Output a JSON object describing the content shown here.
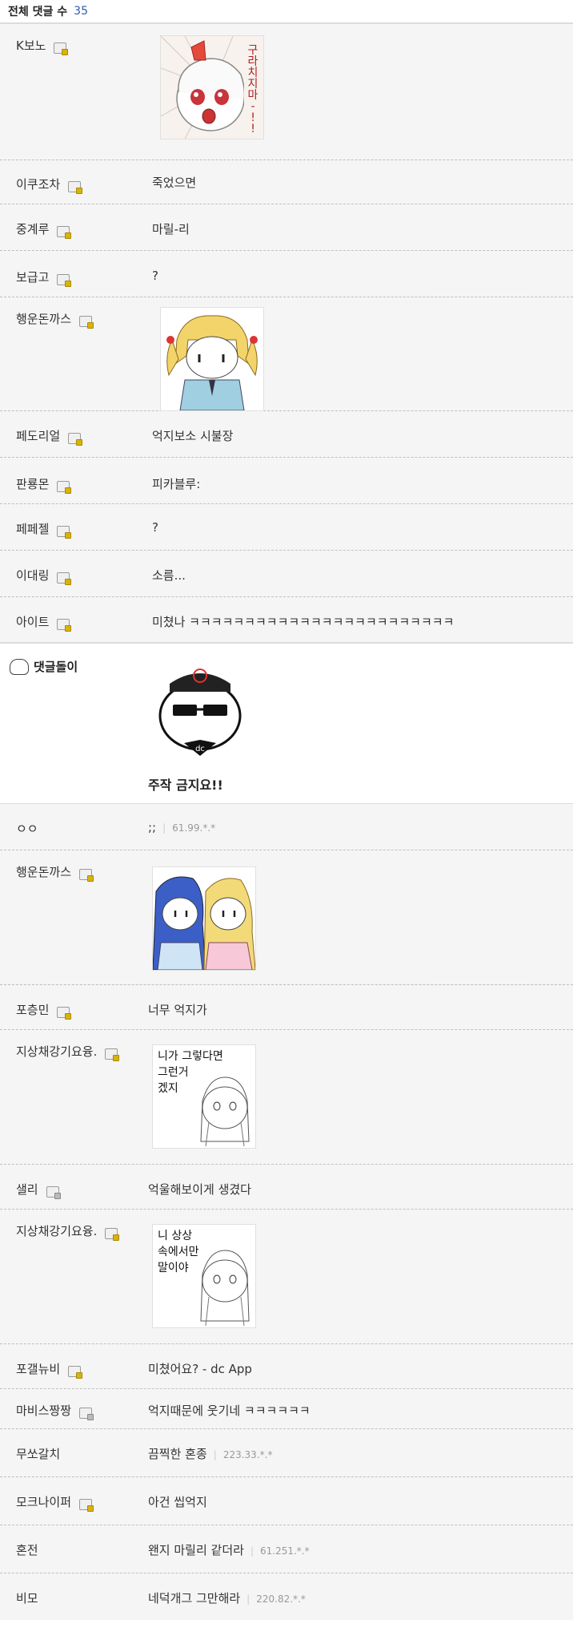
{
  "header": {
    "title": "전체 댓글 수",
    "count": "35"
  },
  "comments": [
    {
      "nick": "K보노",
      "memo": ""
    },
    {
      "nick": "이쿠조차",
      "memo": "죽었으면"
    },
    {
      "nick": "중계루",
      "memo": "마릴-리"
    },
    {
      "nick": "보급고",
      "memo": "?"
    },
    {
      "nick": "행운돈까스",
      "memo": ""
    },
    {
      "nick": "페도리얼",
      "memo": "억지보소 시불장"
    },
    {
      "nick": "판룡몬",
      "memo": "피카블루:"
    },
    {
      "nick": "페페젤",
      "memo": "?"
    },
    {
      "nick": "이대링",
      "memo": "소름..."
    },
    {
      "nick": "아이트",
      "memo": "미쳤나 ㅋㅋㅋㅋㅋㅋㅋㅋㅋㅋㅋㅋㅋㅋㅋㅋㅋㅋㅋㅋㅋㅋㅋㅋ"
    }
  ],
  "bot": {
    "name": "댓글돌이",
    "caption": "주작 금지요!!",
    "badge": "dc"
  },
  "manga": {
    "k_bono": "구라치지마-!!",
    "jisang1": [
      "니가 그렇다면",
      "그런거",
      "겠지"
    ],
    "jisang2": [
      "니 상상",
      "속에서만",
      "말이야"
    ]
  },
  "comments2": [
    {
      "nick": "ㅇㅇ",
      "memo": ";;",
      "ip": "61.99.*.*"
    },
    {
      "nick": "행운돈까스",
      "memo": ""
    },
    {
      "nick": "포층민",
      "memo": "너무 억지가"
    },
    {
      "nick": "지상채강기요융.",
      "memo": ""
    },
    {
      "nick": "샐리",
      "memo": "억울해보이게 생겼다"
    },
    {
      "nick": "지상채강기요융.",
      "memo": ""
    },
    {
      "nick": "포갤뉴비",
      "memo": "미쳤어요? - dc App"
    },
    {
      "nick": "마비스짱짱",
      "memo": "억지때문에 웃기네 ㅋㅋㅋㅋㅋㅋ"
    },
    {
      "nick": "무쏘갈치",
      "memo": "끔찍한 혼종",
      "ip": "223.33.*.*"
    },
    {
      "nick": "모크나이퍼",
      "memo": "아건 씹억지"
    },
    {
      "nick": "혼전",
      "memo": "왠지 마릴리 같더라",
      "ip": "61.251.*.*"
    },
    {
      "nick": "비모",
      "memo": "네덕개그 그만해라",
      "ip": "220.82.*.*"
    }
  ]
}
